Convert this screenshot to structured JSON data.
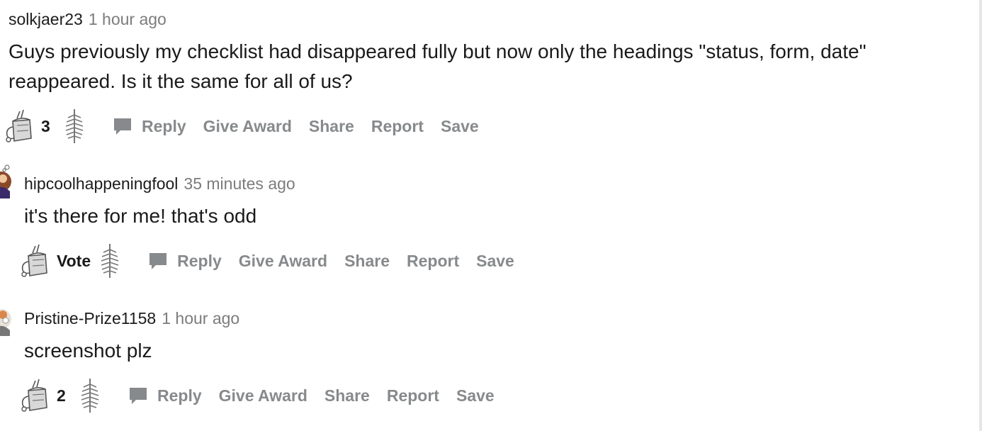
{
  "comments": [
    {
      "username": "solkjaer23",
      "timestamp": "1 hour ago",
      "body": "Guys previously my checklist had disappeared fully but now only the headings \"status, form, date\" reappeared. Is it the same for all of us?",
      "vote_label": "3",
      "actions": {
        "reply": "Reply",
        "award": "Give Award",
        "share": "Share",
        "report": "Report",
        "save": "Save"
      }
    },
    {
      "username": "hipcoolhappeningfool",
      "timestamp": "35 minutes ago",
      "body": "it's there for me! that's odd",
      "vote_label": "Vote",
      "actions": {
        "reply": "Reply",
        "award": "Give Award",
        "share": "Share",
        "report": "Report",
        "save": "Save"
      }
    },
    {
      "username": "Pristine-Prize1158",
      "timestamp": "1 hour ago",
      "body": "screenshot plz",
      "vote_label": "2",
      "actions": {
        "reply": "Reply",
        "award": "Give Award",
        "share": "Share",
        "report": "Report",
        "save": "Save"
      }
    }
  ],
  "icons": {
    "upvote": "upvote-kettle-icon",
    "downvote": "downvote-leaf-icon",
    "reply": "comment-bubble-icon",
    "avatar": "user-avatar-icon"
  },
  "colors": {
    "action_text": "#878a8c",
    "timestamp": "#7c7c7c",
    "body_text": "#1a1a1b"
  }
}
